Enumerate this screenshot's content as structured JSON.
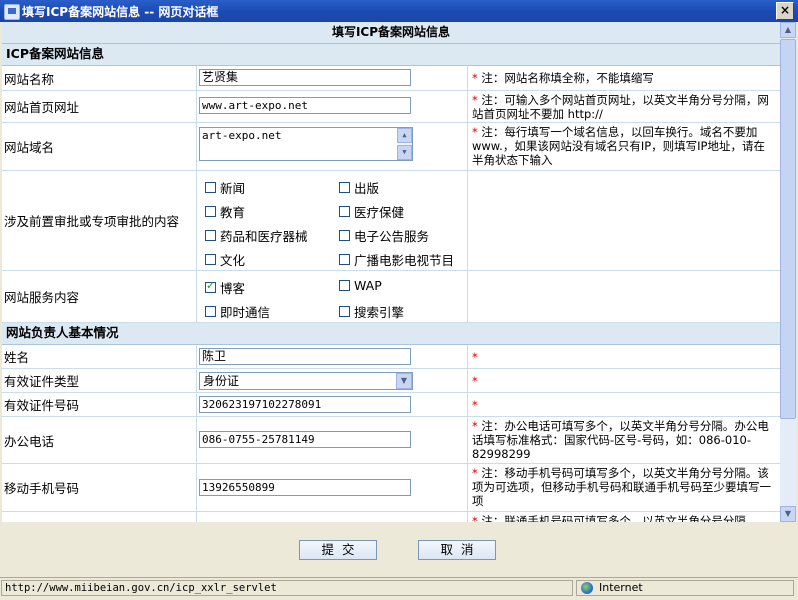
{
  "window": {
    "title": "填写ICP备案网站信息 -- 网页对话框",
    "close": "×"
  },
  "page_title": "填写ICP备案网站信息",
  "sections": {
    "site_info": "ICP备案网站信息",
    "owner_info": "网站负责人基本情况"
  },
  "site": {
    "name_label": "网站名称",
    "name_value": "艺贤集",
    "name_note": "注：网站名称填全称，不能填缩写",
    "home_label": "网站首页网址",
    "home_value": "www.art-expo.net",
    "home_note": "注：可输入多个网站首页网址，以英文半角分号分隔，网站首页网址不要加 http://",
    "domain_label": "网站域名",
    "domain_value": "art-expo.net",
    "domain_note": "注：每行填写一个域名信息，以回车换行。域名不要加 www.，如果该网站没有域名只有IP，则填写IP地址，请在半角状态下输入",
    "approval_label": "涉及前置审批或专项审批的内容",
    "approval_options": [
      "新闻",
      "出版",
      "教育",
      "医疗保健",
      "药品和医疗器械",
      "电子公告服务",
      "文化",
      "广播电影电视节目"
    ],
    "service_label": "网站服务内容",
    "service_options": [
      "博客",
      "WAP",
      "即时通信",
      "搜索引擎"
    ]
  },
  "owner": {
    "name_label": "姓名",
    "name_value": "陈卫",
    "id_type_label": "有效证件类型",
    "id_type_value": "身份证",
    "id_no_label": "有效证件号码",
    "id_no_value": "320623197102278091",
    "office_label": "办公电话",
    "office_value": "086-0755-25781149",
    "office_note": "注：办公电话可填写多个，以英文半角分号分隔。办公电话填写标准格式：国家代码-区号-号码，如：086-010-82998299",
    "mobile_label": "移动手机号码",
    "mobile_value": "13926550899",
    "mobile_note": "注：移动手机号码可填写多个，以英文半角分号分隔。该项为可选项，但移动手机号码和联通手机号码至少要填写一项",
    "unicom_note": "注：联通手机号码可填写多个，以英文半角分号分隔"
  },
  "required_mark": "*",
  "buttons": {
    "submit": "提交",
    "cancel": "取消"
  },
  "status": {
    "url": "http://www.miibeian.gov.cn/icp_xxlr_servlet",
    "zone": "Internet"
  },
  "colors": {
    "title_bar": "#1d4bb4",
    "section_bg": "#dce9f3",
    "required": "#d00000"
  }
}
